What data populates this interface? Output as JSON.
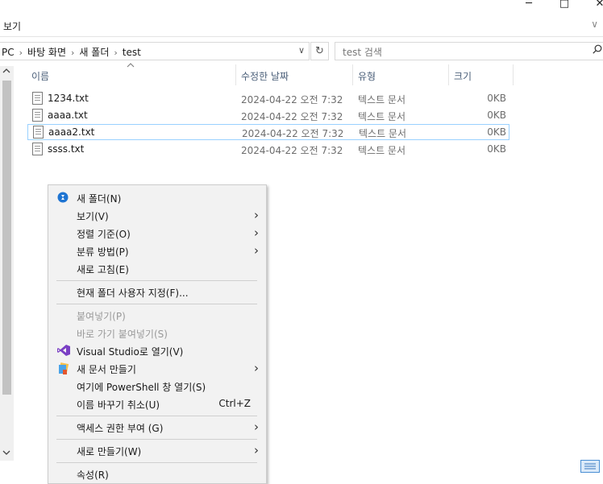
{
  "window": {
    "minimize_glyph": "─",
    "maximize_glyph": "□",
    "close_glyph": "✕"
  },
  "ribbon": {
    "label": "보기",
    "chevron": "∨"
  },
  "address": {
    "crumbs": [
      "PC",
      "바탕 화면",
      "새 폴더",
      "test"
    ],
    "separator": "›",
    "dropdown_glyph": "∨",
    "refresh_glyph": "↻"
  },
  "search": {
    "placeholder": "test 검색",
    "icon": "search-icon"
  },
  "columns": {
    "name": "이름",
    "modified": "수정한 날짜",
    "type": "유형",
    "size": "크기"
  },
  "files": [
    {
      "name": "1234.txt",
      "modified": "2024-04-22 오전 7:32",
      "type": "텍스트 문서",
      "size": "0KB"
    },
    {
      "name": "aaaa.txt",
      "modified": "2024-04-22 오전 7:32",
      "type": "텍스트 문서",
      "size": "0KB"
    },
    {
      "name": "aaaa2.txt",
      "modified": "2024-04-22 오전 7:32",
      "type": "텍스트 문서",
      "size": "0KB"
    },
    {
      "name": "ssss.txt",
      "modified": "2024-04-22 오전 7:32",
      "type": "텍스트 문서",
      "size": "0KB"
    }
  ],
  "context_menu": {
    "new_folder": "새 폴더(N)",
    "view": "보기(V)",
    "sort_by": "정렬 기준(O)",
    "group_by": "분류 방법(P)",
    "refresh": "새로 고침(E)",
    "customize": "현재 폴더 사용자 지정(F)...",
    "paste": "붙여넣기(P)",
    "paste_shortcut": "바로 가기 붙여넣기(S)",
    "open_vs": "Visual Studio로 열기(V)",
    "new_document": "새 문서 만들기",
    "open_powershell": "여기에 PowerShell 창 열기(S)",
    "undo_rename": "이름 바꾸기 취소(U)",
    "undo_rename_shortcut": "Ctrl+Z",
    "give_access": "액세스 권한 부여 (G)",
    "new": "새로 만들기(W)",
    "properties": "속성(R)",
    "submenu_glyph": "›"
  },
  "colors": {
    "accent": "#0078d7",
    "selection_border": "#99d1ff",
    "header_text": "#4c607a"
  }
}
